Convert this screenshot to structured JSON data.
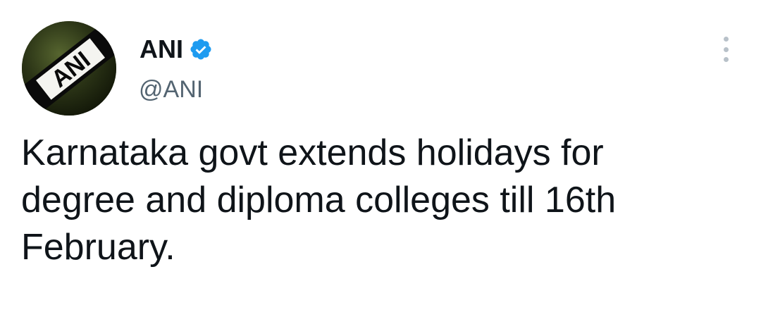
{
  "author": {
    "display_name": "ANI",
    "handle": "@ANI",
    "avatar_text": "ANI",
    "verified": true,
    "verified_color": "#1d9bf0"
  },
  "tweet": {
    "text": "Karnataka govt extends holidays for degree and diploma colleges till 16th February."
  },
  "icons": {
    "more": "more-vertical-icon",
    "verified": "verified-badge-icon"
  }
}
